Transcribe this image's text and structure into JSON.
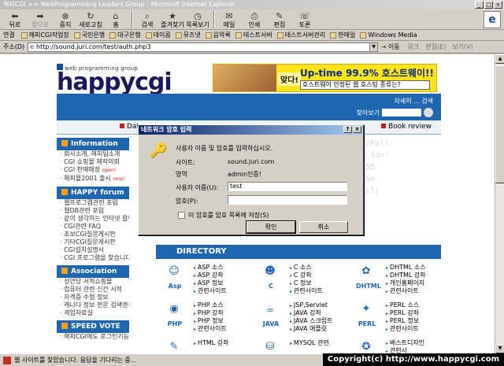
{
  "window": {
    "title": "해피CGI >> WebProgramming Leaders Group - Microsoft Internet Explorer"
  },
  "toolbar": {
    "buttons": [
      {
        "label": "뒤로",
        "icon": "back-arrow-icon",
        "enabled": true
      },
      {
        "label": "앞으로",
        "icon": "forward-arrow-icon",
        "enabled": false
      },
      {
        "label": "중지",
        "icon": "stop-icon",
        "enabled": true
      },
      {
        "label": "새로고침",
        "icon": "refresh-icon",
        "enabled": true
      },
      {
        "label": "홈",
        "icon": "home-icon",
        "enabled": true
      },
      {
        "label": "검색",
        "icon": "search-icon",
        "enabled": true
      },
      {
        "label": "즐겨찾기",
        "icon": "favorites-icon",
        "enabled": true
      },
      {
        "label": "목록보기",
        "icon": "history-icon",
        "enabled": true
      },
      {
        "label": "메일",
        "icon": "mail-icon",
        "enabled": true
      },
      {
        "label": "인쇄",
        "icon": "print-icon",
        "enabled": true
      },
      {
        "label": "편집",
        "icon": "edit-icon",
        "enabled": true
      },
      {
        "label": "토론",
        "icon": "discuss-icon",
        "enabled": true
      }
    ]
  },
  "links": {
    "label": "연결",
    "items": [
      "해피CGI작업장",
      "국민은행",
      "대구은행",
      "데이콤",
      "뮤즈넷",
      "음악록",
      "테스트서버",
      "테스트서버관리",
      "한메일",
      "Windows Media"
    ]
  },
  "address": {
    "label": "주소(D)",
    "url": "http://sound.juri.com/test/auth.php3",
    "go": "이동",
    "right": [
      "링크",
      "편집(E)",
      "보기(V)"
    ]
  },
  "page": {
    "logo_sub": "web programming group",
    "logo": "happycgi",
    "banner": {
      "mat": "맞다!",
      "uptime": "Up-time 99.9% 호스트웨이!!",
      "select": "호스트웨이 안정된 웹 호스팅 종류는?"
    },
    "search_label": "자세히 ... 검색",
    "find_label": "찾아보기",
    "tab_left": "Dat",
    "tab_right": "Book review",
    "left": {
      "info_title": "Information",
      "info_items": [
        "회사소개, 해피팀소개",
        "CGI 쇼핑몰 제작의뢰",
        "CGI 판매매장",
        "해피몰2001 출시"
      ],
      "open_badge": "open!",
      "new_badge": "new!",
      "forum_title": "HAPPY forum",
      "forum_items": [
        "웹프로그램관련 포럼",
        "웹DB관련 포럼",
        "같이 생각하는 인터넷 칼럼",
        "CGI관련 FAQ",
        "초보CGI질문게시판",
        "기타CGI질문게시판",
        "CGI설치설명서",
        "CGI 프로그램을 찾습니다"
      ],
      "assoc_title": "Association",
      "assoc_items": [
        "성안당 서적쇼핑몰",
        "컴퓨터 관련 신간 서적",
        "자격증 수험 정보",
        "캐나다 정보 전문 검색엔진",
        "게임자료실"
      ],
      "vote_title": "SPEED VOTE",
      "vote_item": "해피CGI에도 로그인기능이"
    },
    "directory": {
      "title": "DIRECTORY",
      "groups": [
        {
          "label": "Asp",
          "icon": "asp-icon",
          "items": [
            "ASP 소스",
            "ASP 강좌",
            "ASP 정보",
            "관련사이트"
          ]
        },
        {
          "label": "C",
          "icon": "c-icon",
          "items": [
            "C 소스",
            "C 강좌",
            "C 정보",
            "관련사이트"
          ]
        },
        {
          "label": "DHTML",
          "icon": "dhtml-icon",
          "items": [
            "DHTML 소스",
            "DHTML 강좌",
            "개인홈페이지",
            "관련사이트"
          ]
        },
        {
          "label": "PHP",
          "icon": "php-icon",
          "items": [
            "PHP 소스",
            "PHP 강좌",
            "PHP 정보",
            "관련사이트"
          ]
        },
        {
          "label": "JAVA",
          "icon": "java-icon",
          "items": [
            "JSP,Servlet",
            "JAVA 강좌",
            "JAVA 스크립트",
            "JAVA 애플릿"
          ]
        },
        {
          "label": "PERL",
          "icon": "perl-icon",
          "items": [
            "PERL 소스",
            "PERL 강좌",
            "PERL 정보",
            "관련사이트"
          ]
        },
        {
          "label": "",
          "icon": "html-icon",
          "items": [
            "HTML 강좌"
          ]
        },
        {
          "label": "",
          "icon": "mysql-icon",
          "items": [
            "MYSQL 관련"
          ]
        },
        {
          "label": "",
          "icon": "best-icon",
          "items": [
            "베스트디자인",
            "관련사"
          ]
        }
      ]
    },
    "bgcode": [
      "vote/Poll",
      "poll_id=\"",
      "id=355",
      "mailin",
      "}\")(if("
    ]
  },
  "dialog": {
    "title": "네트워크 암호 입력",
    "prompt": "사용자 이름 및 암호를 입력하십시오.",
    "site_label": "사이트:",
    "site_value": "sound.juri.com",
    "realm_label": "영역",
    "realm_value": "admin인증!",
    "user_label": "사용자 이름(U):",
    "user_value": "test",
    "pass_label": "암호(P):",
    "pass_value": "",
    "save_label": "이 암호를 암호 목록에 저장(S)",
    "ok": "확인",
    "cancel": "취소"
  },
  "status": {
    "text": "웹 사이트를 찾았습니다. 응답을 기다리는 중..."
  },
  "copyright": "Copyright(c) http://www.happycgi.com"
}
